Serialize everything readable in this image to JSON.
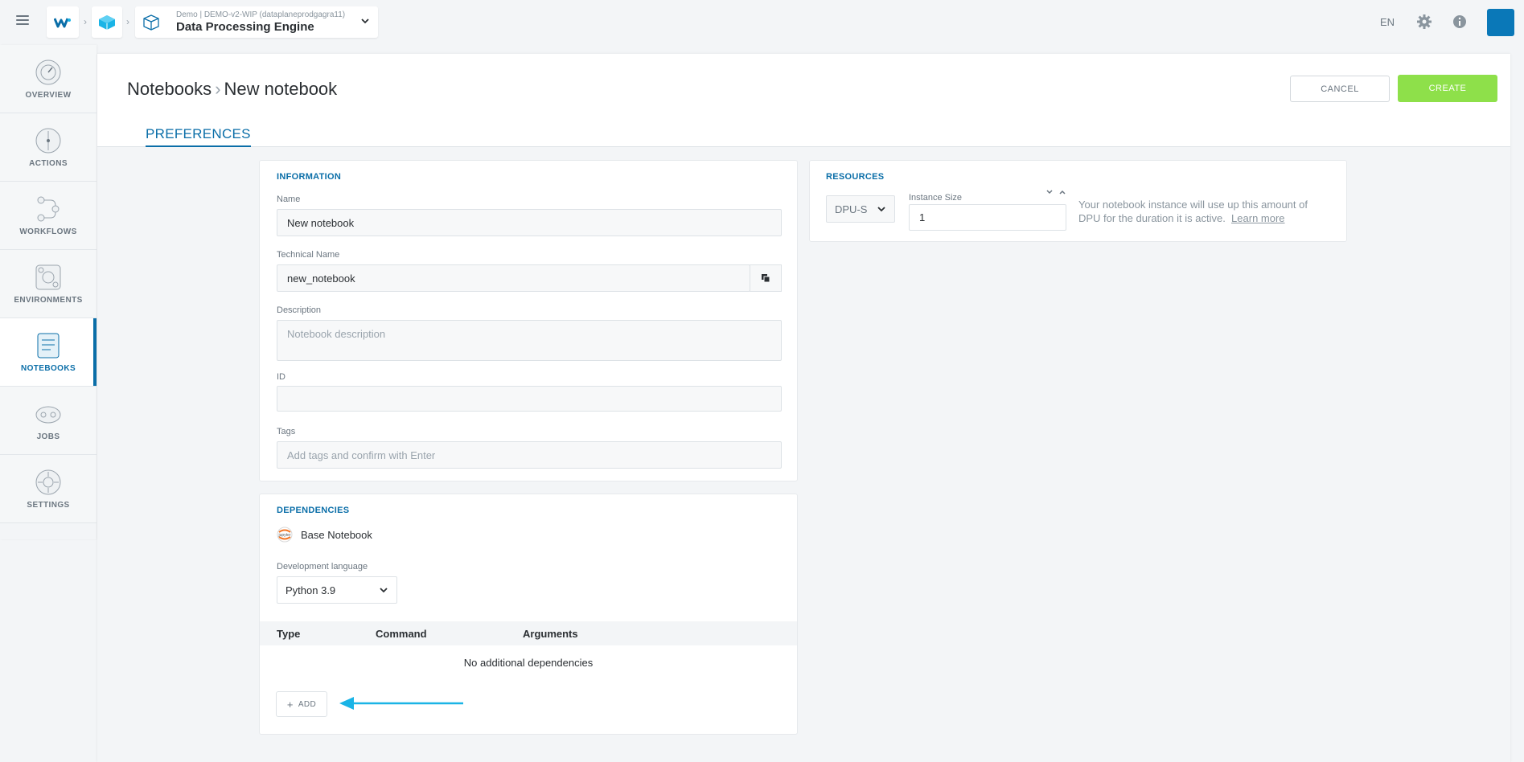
{
  "topbar": {
    "project_sub": "Demo | DEMO-v2-WIP (dataplaneprodgagra11)",
    "project_title": "Data Processing Engine",
    "lang": "EN"
  },
  "sidebar": {
    "items": [
      {
        "label": "OVERVIEW",
        "icon": "overview-icon",
        "active": false
      },
      {
        "label": "ACTIONS",
        "icon": "actions-icon",
        "active": false
      },
      {
        "label": "WORKFLOWS",
        "icon": "workflows-icon",
        "active": false
      },
      {
        "label": "ENVIRONMENTS",
        "icon": "environments-icon",
        "active": false
      },
      {
        "label": "NOTEBOOKS",
        "icon": "notebooks-icon",
        "active": true
      },
      {
        "label": "JOBS",
        "icon": "jobs-icon",
        "active": false
      },
      {
        "label": "SETTINGS",
        "icon": "settings-icon",
        "active": false
      }
    ]
  },
  "header": {
    "breadcrumb_parent": "Notebooks",
    "breadcrumb_current": "New notebook",
    "cancel_label": "CANCEL",
    "create_label": "CREATE",
    "tab_label": "PREFERENCES"
  },
  "information": {
    "title": "INFORMATION",
    "name_label": "Name",
    "name_value": "New notebook",
    "technical_label": "Technical Name",
    "technical_value": "new_notebook",
    "description_label": "Description",
    "description_placeholder": "Notebook description",
    "id_label": "ID",
    "id_value": "",
    "tags_label": "Tags",
    "tags_placeholder": "Add tags and confirm with Enter"
  },
  "dependencies": {
    "title": "DEPENDENCIES",
    "base_label": "Base Notebook",
    "language_label": "Development language",
    "language_value": "Python 3.9",
    "columns": [
      "Type",
      "Command",
      "Arguments"
    ],
    "empty_text": "No additional dependencies",
    "add_label": "ADD"
  },
  "resources": {
    "title": "RESOURCES",
    "dpu_value": "DPU-S",
    "instance_label": "Instance Size",
    "instance_value": "1",
    "help_text_1": "Your notebook instance will use up this amount of",
    "help_text_2": "DPU for the duration it is active.",
    "learn_more": "Learn more"
  },
  "colors": {
    "accent": "#0a6ea8",
    "create_button": "#8ee04a",
    "arrow": "#1ab4e6"
  }
}
